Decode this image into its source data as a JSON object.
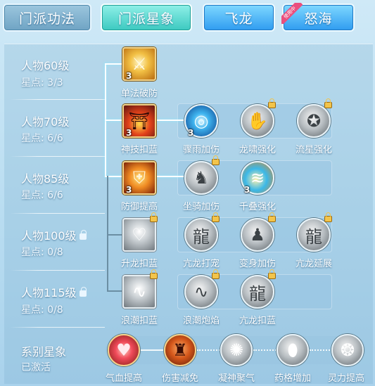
{
  "tabs": [
    {
      "label": "门派功法"
    },
    {
      "label": "门派星象"
    },
    {
      "label": "飞龙"
    },
    {
      "label": "怒海",
      "badge": "使用中"
    }
  ],
  "rows": [
    {
      "level": "人物60级",
      "points": "星点: 3/3",
      "locked": false
    },
    {
      "level": "人物70级",
      "points": "星点: 6/6",
      "locked": false
    },
    {
      "level": "人物85级",
      "points": "星点: 6/6",
      "locked": false
    },
    {
      "level": "人物100级",
      "points": "星点: 0/8",
      "locked": true
    },
    {
      "level": "人物115级",
      "points": "星点: 0/8",
      "locked": true
    }
  ],
  "skills": {
    "r1": [
      {
        "name": "单法破防",
        "count": "3",
        "icon": "sword-break-icon"
      }
    ],
    "r2": [
      {
        "name": "神技扣蓝",
        "count": "3",
        "icon": "pagoda-fire-icon"
      },
      {
        "name": "骤雨加伤",
        "count": "3",
        "icon": "water-vortex-icon"
      },
      {
        "name": "龙啸强化",
        "count": "",
        "icon": "claw-icon"
      },
      {
        "name": "流星强化",
        "count": "",
        "icon": "meteor-icon"
      }
    ],
    "r3": [
      {
        "name": "防御提高",
        "count": "3",
        "icon": "shield-fire-icon"
      },
      {
        "name": "坐骑加伤",
        "count": "",
        "icon": "beast-icon"
      },
      {
        "name": "千叠强化",
        "count": "3",
        "icon": "wave-icon"
      }
    ],
    "r4": [
      {
        "name": "升龙扣蓝",
        "count": "",
        "icon": "heart-dragon-icon"
      },
      {
        "name": "亢龙打宠",
        "count": "",
        "icon": "dragon-icon"
      },
      {
        "name": "变身加伤",
        "count": "",
        "icon": "figure-icon"
      },
      {
        "name": "亢龙延展",
        "count": "",
        "icon": "dragon-icon"
      }
    ],
    "r5": [
      {
        "name": "浪潮扣蓝",
        "count": "",
        "icon": "tide-icon"
      },
      {
        "name": "浪潮炮焰",
        "count": "",
        "icon": "tide-icon"
      },
      {
        "name": "亢龙扣蓝",
        "count": "",
        "icon": "dragon-icon"
      }
    ]
  },
  "series": {
    "title": "系别星象",
    "status": "已激活",
    "items": [
      {
        "name": "气血提高",
        "icon": "heart-icon"
      },
      {
        "name": "伤害减免",
        "icon": "warrior-icon"
      },
      {
        "name": "凝神聚气",
        "icon": "aura-icon"
      },
      {
        "name": "药格增加",
        "icon": "potion-icon"
      },
      {
        "name": "灵力提高",
        "icon": "spirit-icon"
      }
    ]
  },
  "colors": {
    "active_tab": "#3cc9c0",
    "blue_tab": "#2f9cf0",
    "badge": "#ea4f7d",
    "lock": "#f2c44b"
  }
}
